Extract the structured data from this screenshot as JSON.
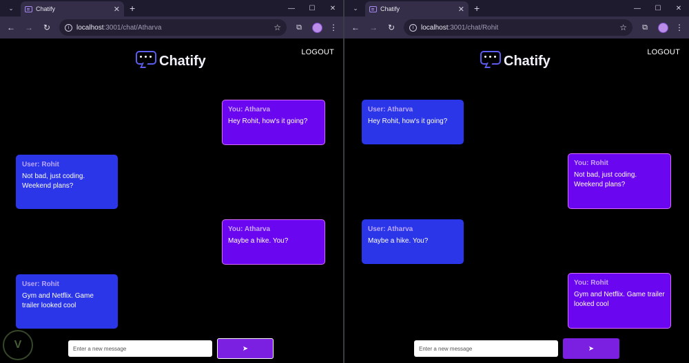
{
  "left": {
    "tab": {
      "title": "Chatify",
      "close": "✕"
    },
    "newtab": "+",
    "window_controls": {
      "minimize": "—",
      "maximize": "☐",
      "close": "✕"
    },
    "url": {
      "host": "localhost",
      "path": ":3001/chat/Atharva"
    },
    "brand": "Chatify",
    "logout": "LOGOUT",
    "messages": [
      {
        "sender": "You: Atharva",
        "text": "Hey Rohit, how's it going?"
      },
      {
        "sender": "User: Rohit",
        "text": "Not bad, just coding. Weekend plans?"
      },
      {
        "sender": "You: Atharva",
        "text": "Maybe a hike. You?"
      },
      {
        "sender": "User: Rohit",
        "text": "Gym and Netflix. Game trailer looked cool"
      }
    ],
    "composer": {
      "placeholder": "Enter a new message",
      "send_icon": "➤"
    }
  },
  "right": {
    "tab": {
      "title": "Chatify",
      "close": "✕"
    },
    "newtab": "+",
    "window_controls": {
      "minimize": "—",
      "maximize": "☐",
      "close": "✕"
    },
    "url": {
      "host": "localhost",
      "path": ":3001/chat/Rohit"
    },
    "brand": "Chatify",
    "logout": "LOGOUT",
    "messages": [
      {
        "sender": "User: Atharva",
        "text": "Hey Rohit, how's it going?"
      },
      {
        "sender": "You: Rohit",
        "text": "Not bad, just coding. Weekend plans?"
      },
      {
        "sender": "User: Atharva",
        "text": "Maybe a hike. You?"
      },
      {
        "sender": "You: Rohit",
        "text": "Gym and Netflix. Game trailer looked cool"
      }
    ],
    "composer": {
      "placeholder": "Enter a new message",
      "send_icon": "➤"
    }
  },
  "colors": {
    "incoming": "#2b36e8",
    "outgoing": "#6a06f0",
    "send_button": "#7b1fe0"
  },
  "icons": [
    "chatify-logo-icon",
    "send-icon",
    "back-arrow-icon",
    "forward-arrow-icon",
    "reload-icon",
    "site-info-icon",
    "bookmark-star-icon",
    "extensions-icon",
    "profile-avatar",
    "kebab-menu-icon"
  ]
}
